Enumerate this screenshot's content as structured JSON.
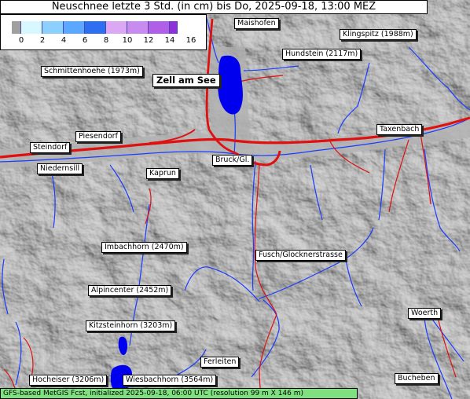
{
  "title": "Neuschnee letzte 3 Std. (in cm) bis Do, 2025-09-18, 13:00 MEZ",
  "legend": {
    "ticks": [
      "0",
      "2",
      "4",
      "6",
      "8",
      "10",
      "12",
      "14",
      "16"
    ],
    "colors": [
      "#a0a0a0",
      "#d8f8ff",
      "#8cd0ff",
      "#5aa8ff",
      "#2e6ef0",
      "#dca8f4",
      "#c88cf0",
      "#b060e8",
      "#9030d8"
    ]
  },
  "places": [
    {
      "label": "Maishofen"
    },
    {
      "label": "Klingspitz (1988m)"
    },
    {
      "label": "Hundstein (2117m)"
    },
    {
      "label": "Schmittenhoehe (1973m)"
    },
    {
      "label": "Zell am See"
    },
    {
      "label": "Taxenbach"
    },
    {
      "label": "Piesendorf"
    },
    {
      "label": "Steindorf"
    },
    {
      "label": "Niedernsill"
    },
    {
      "label": "Bruck/Gl."
    },
    {
      "label": "Kaprun"
    },
    {
      "label": "Imbachhorn (2470m)"
    },
    {
      "label": "Fusch/Glocknerstrasse"
    },
    {
      "label": "Alpincenter (2452m)"
    },
    {
      "label": "Kitzsteinhorn (3203m)"
    },
    {
      "label": "Woerth"
    },
    {
      "label": "Ferleiten"
    },
    {
      "label": "Hocheiser (3206m)"
    },
    {
      "label": "Wiesbachhorn (3564m)"
    },
    {
      "label": "Bucheben"
    }
  ],
  "footer": "GFS-based MetGIS Fcst, initialized 2025-09-18, 06:00 UTC  (resolution 99 m X 146 m)",
  "colors": {
    "road": "#e01010",
    "river": "#1a3cff",
    "lake": "#0000ee",
    "footer_bg": "#7fe07f"
  }
}
